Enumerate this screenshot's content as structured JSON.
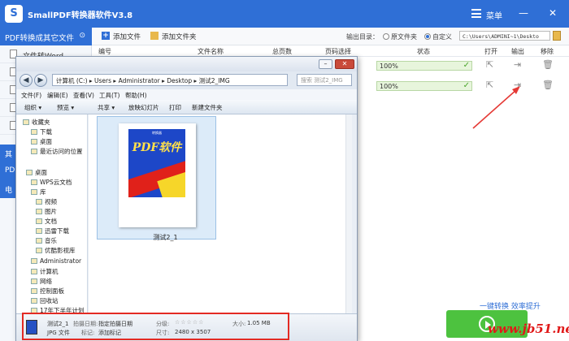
{
  "app": {
    "title": "SmallPDF转换器软件V3.8",
    "logo_text": "S",
    "menu_label": "菜单",
    "win_min": "—",
    "win_close": "✕"
  },
  "leftnav": {
    "category_title": "PDF转换成其它文件",
    "collapse_icon": "⊙",
    "items": [
      "文件转Word"
    ],
    "partial_categories": [
      "其",
      "PD",
      "电"
    ]
  },
  "toolbar": {
    "add_file": "添加文件",
    "add_folder": "添加文件夹",
    "output_label": "输出目录：",
    "radio_original": "原文件夹",
    "radio_custom": "自定义",
    "output_path": "C:\\Users\\ADMINI~1\\Deskto"
  },
  "columns": {
    "index": "编号",
    "filename": "文件名称",
    "pages": "总页数",
    "page_select": "页码选择",
    "status": "状态",
    "open": "打开",
    "output": "输出",
    "remove": "移除"
  },
  "rows": [
    {
      "progress": "100%"
    },
    {
      "progress": "100%"
    }
  ],
  "bottom": {
    "links": "一键转换  效率提升",
    "start_button": "开始转换"
  },
  "watermark": "www.jb51.net",
  "explorer": {
    "address": "计算机 (C:) ▸ Users ▸ Administrator ▸ Desktop ▸ 测试2_IMG",
    "search_placeholder": "搜索 测试2_IMG",
    "nav_back": "◀",
    "nav_fwd": "▶",
    "menu": [
      "文件(F)",
      "编辑(E)",
      "查看(V)",
      "工具(T)",
      "帮助(H)"
    ],
    "commands": [
      "组织 ▾",
      "预览 ▾",
      "共享 ▾",
      "放映幻灯片",
      "打印",
      "新建文件夹"
    ],
    "nav_items": [
      "收藏夹",
      "下载",
      "桌面",
      "最近访问的位置",
      "桌面",
      "WPS云文档",
      "库",
      "视频",
      "图片",
      "文档",
      "迅雷下载",
      "音乐",
      "优酷影视库",
      "Administrator",
      "计算机",
      "网络",
      "控制面板",
      "回收站",
      "17年下半年计划"
    ],
    "file": {
      "name": "测试2_1",
      "cover_text": "PDF软件",
      "cover_small": "转换器"
    },
    "details": {
      "name": "测试2_1",
      "type": "JPG 文件",
      "date_label": "拍摄日期:",
      "date_value": "指定拍摄日期",
      "tags_label": "标记:",
      "tags_value": "添加标记",
      "rating_label": "分级:",
      "rating_stars": "☆☆☆☆☆",
      "dim_label": "尺寸:",
      "dim_value": "2480 x 3507",
      "size_label": "大小:",
      "size_value": "1.05 MB"
    }
  }
}
